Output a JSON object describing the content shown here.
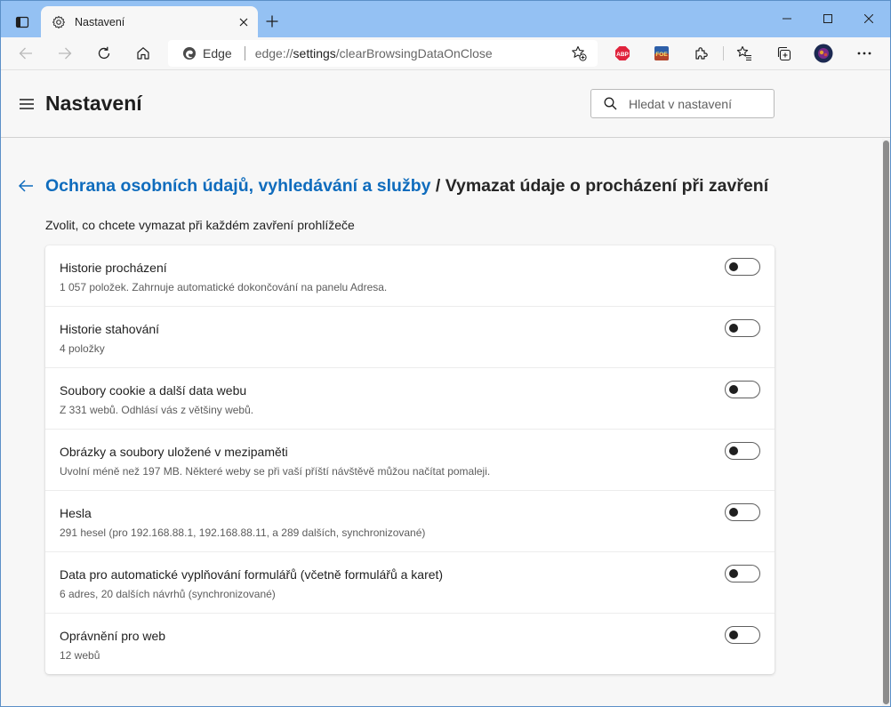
{
  "tab": {
    "title": "Nastavení"
  },
  "address_bar": {
    "site_label": "Edge",
    "url_scheme": "edge://",
    "url_host": "settings",
    "url_path": "/clearBrowsingDataOnClose"
  },
  "extensions": [
    {
      "name": "adblock-plus-icon",
      "text": "ABP",
      "color": "#e0233c"
    },
    {
      "name": "foe-helper-icon",
      "text": "FOE",
      "color": "#2d5fa8"
    }
  ],
  "settings": {
    "title": "Nastavení",
    "search_placeholder": "Hledat v nastavení"
  },
  "page": {
    "breadcrumb_parent": "Ochrana osobních údajů, vyhledávání a služby",
    "breadcrumb_separator": " / ",
    "breadcrumb_current": "Vymazat údaje o procházení při zavření",
    "subtitle": "Zvolit, co chcete vymazat při každém zavření prohlížeče"
  },
  "options": [
    {
      "title": "Historie procházení",
      "description": "1 057 položek. Zahrnuje automatické dokončování na panelu Adresa.",
      "enabled": false
    },
    {
      "title": "Historie stahování",
      "description": "4 položky",
      "enabled": false
    },
    {
      "title": "Soubory cookie a další data webu",
      "description": "Z 331 webů. Odhlásí vás z většiny webů.",
      "enabled": false
    },
    {
      "title": "Obrázky a soubory uložené v mezipaměti",
      "description": "Uvolní méně než 197 MB. Některé weby se při vaší příští návštěvě můžou načítat pomaleji.",
      "enabled": false
    },
    {
      "title": "Hesla",
      "description": "291 hesel (pro 192.168.88.1, 192.168.88.11, a 289 dalších, synchronizované)",
      "enabled": false
    },
    {
      "title": "Data pro automatické vyplňování formulářů (včetně formulářů a karet)",
      "description": "6 adres, 20 dalších návrhů (synchronizované)",
      "enabled": false
    },
    {
      "title": "Oprávnění pro web",
      "description": "12 webů",
      "enabled": false
    }
  ],
  "colors": {
    "accent": "#0f6cbd",
    "titlebar": "#94c1f3",
    "background": "#f7f7f7"
  }
}
